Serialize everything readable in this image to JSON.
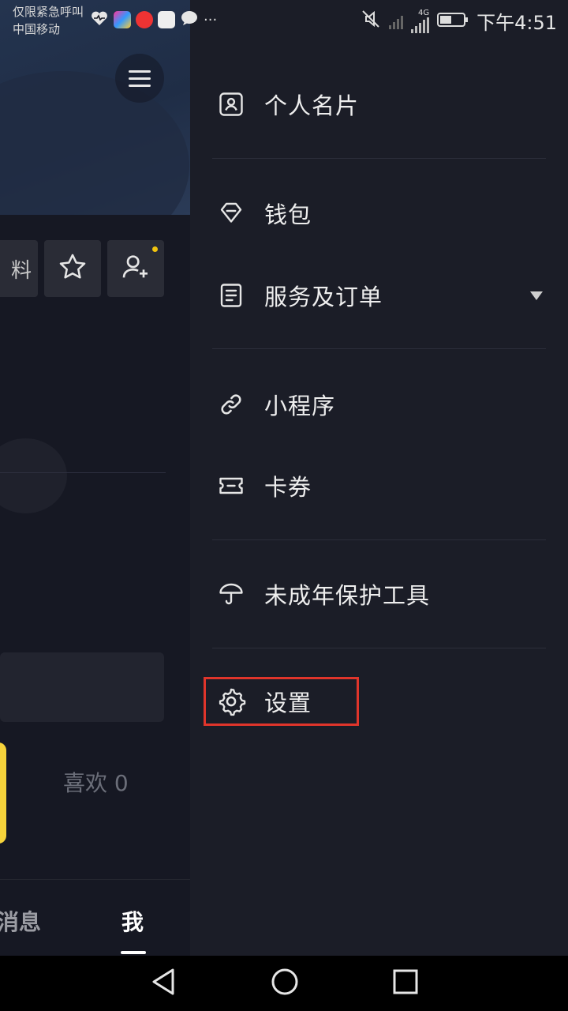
{
  "status_bar": {
    "carrier_line1": "仅限紧急呼叫",
    "carrier_line2": "中国移动",
    "more": "···",
    "network": "4G",
    "time": "下午4:51"
  },
  "profile_bg": {
    "edit_label": "料",
    "likes_label": "喜欢 0",
    "tab_messages": "消息",
    "tab_me": "我"
  },
  "drawer": {
    "items": [
      {
        "label": "个人名片",
        "icon": "contact-card-icon"
      },
      {
        "label": "钱包",
        "icon": "diamond-wallet-icon"
      },
      {
        "label": "服务及订单",
        "icon": "document-list-icon",
        "expandable": true
      },
      {
        "label": "小程序",
        "icon": "link-icon"
      },
      {
        "label": "卡券",
        "icon": "ticket-icon"
      },
      {
        "label": "未成年保护工具",
        "icon": "umbrella-icon"
      },
      {
        "label": "设置",
        "icon": "gear-icon",
        "highlighted": true
      }
    ]
  },
  "colors": {
    "drawer_bg": "#1b1d27",
    "highlight": "#e0352b",
    "accent_yellow": "#f6d33b"
  }
}
